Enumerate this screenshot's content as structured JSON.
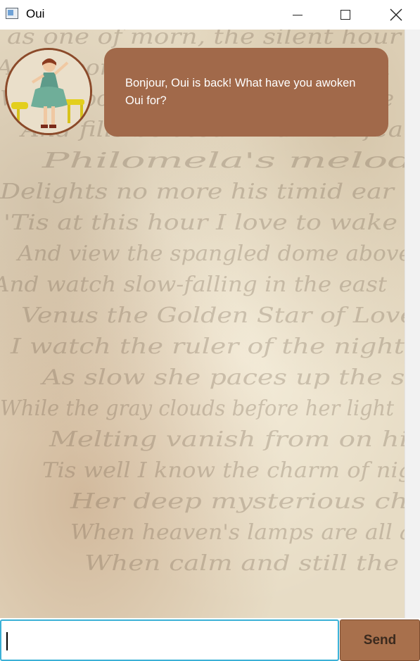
{
  "window": {
    "title": "Oui",
    "controls": {
      "minimize_icon": "minimize-icon",
      "maximize_icon": "maximize-icon",
      "close_icon": "close-icon"
    }
  },
  "chat": {
    "messages": [
      {
        "sender": "bot",
        "avatar_icon": "pinup-avatar",
        "text": "Bonjour, Oui is back! What have you awoken Oui for?"
      }
    ],
    "background_script_lines": [
      "as one of morn, the silent hour",
      "And moonlight silvers all the glen",
      "When hoots the owl in darkling tree",
      "And fills belated hind with fear",
      "Philomela's melody",
      "Delights no more his timid ear",
      "'Tis at this hour I love to wake",
      "And view the spangled dome above",
      "And watch slow-falling in the east",
      "Venus the Golden Star of Love",
      "I watch the ruler of the night",
      "As slow she paces up the sky",
      "While the gray clouds before her light",
      "Melting vanish from on high",
      "Tis well I know the charm of night",
      "Her deep mysterious charm",
      "When heaven's lamps are all alight",
      "When calm and still the earth"
    ]
  },
  "input": {
    "value": "",
    "placeholder": ""
  },
  "send_button": {
    "label": "Send"
  },
  "colors": {
    "bubble": "#a1694a",
    "send_button": "#a8704c",
    "input_focus_border": "#3ab0d6",
    "paper": "#e7dcc5",
    "ink": "#6b5a48"
  }
}
